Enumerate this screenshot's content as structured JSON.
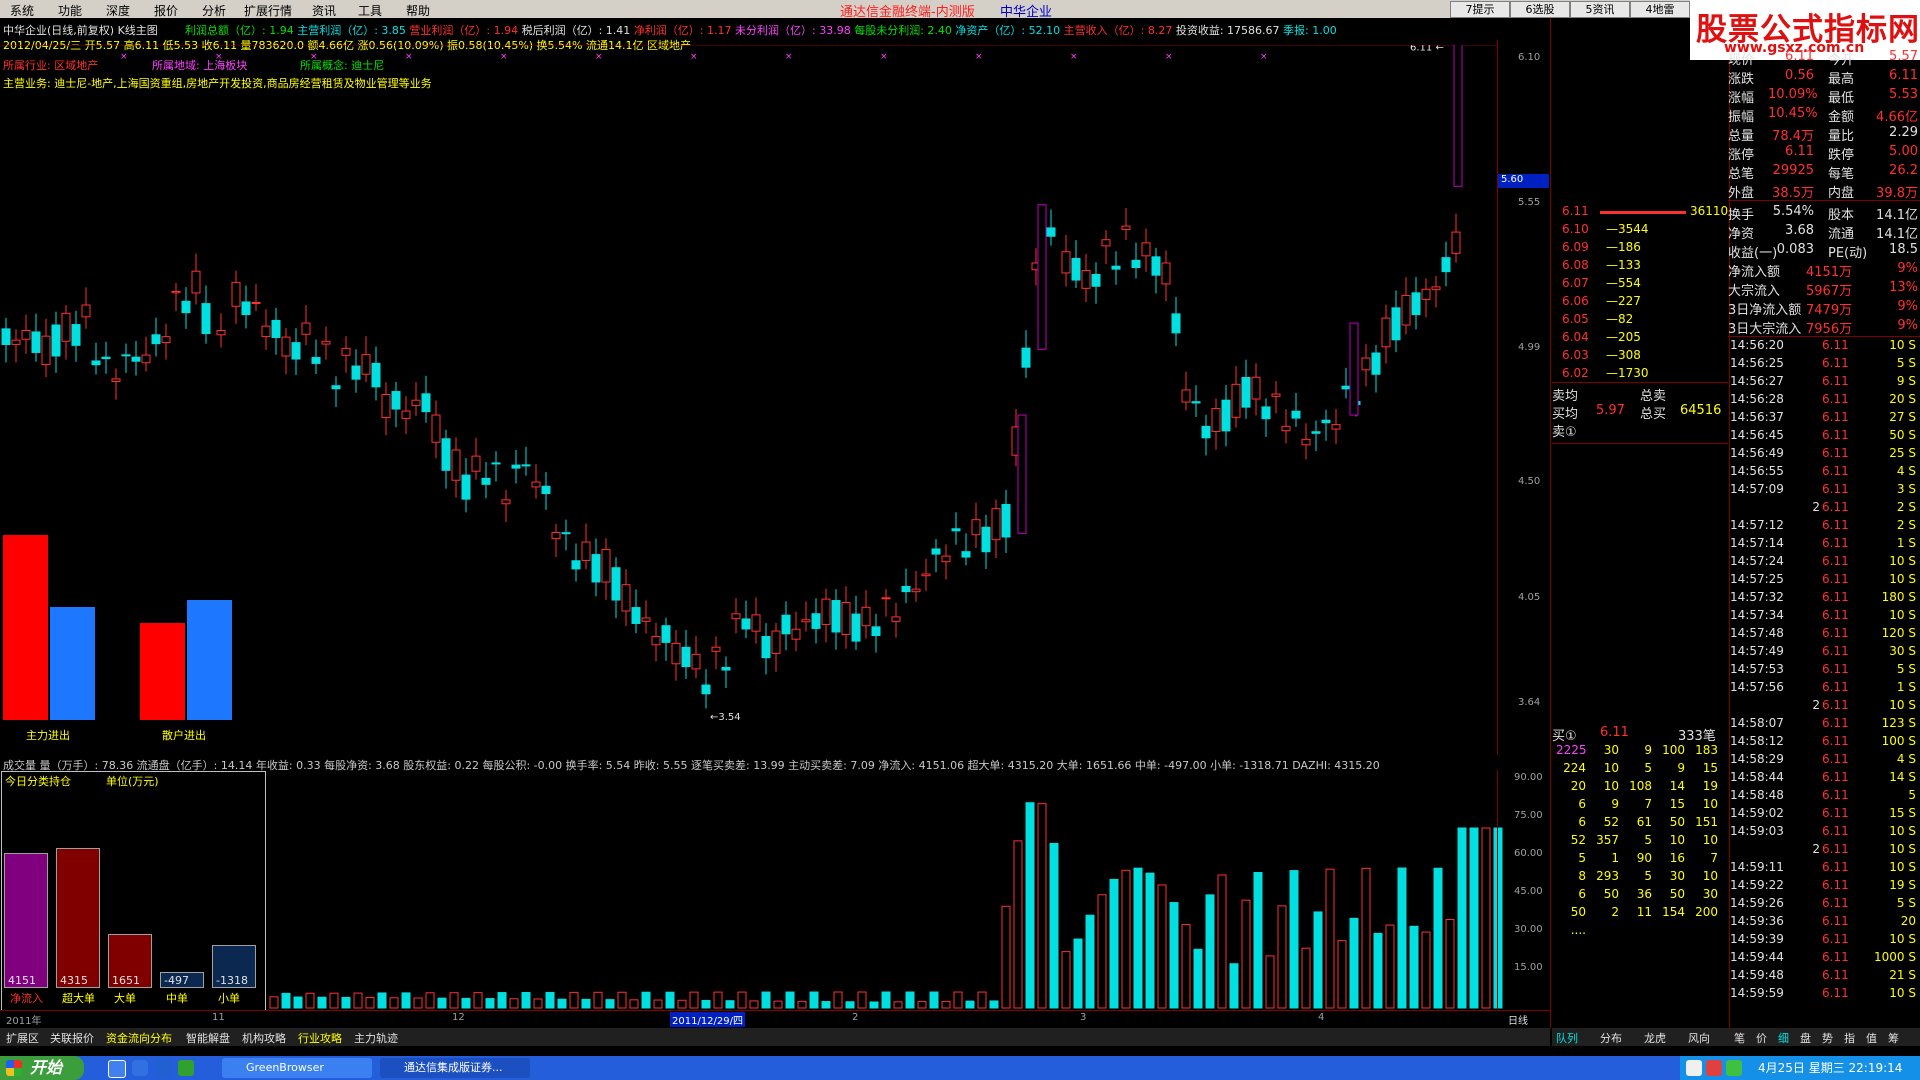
{
  "menu": [
    "系统",
    "功能",
    "深度",
    "报价",
    "分析",
    "扩展行情",
    "资讯",
    "工具",
    "帮助"
  ],
  "app_title": "通达信金融终端-内测版",
  "app_subtitle": "中华企业",
  "top_buttons": [
    "7提示",
    "6选股",
    "5资讯",
    "4地雷"
  ],
  "watermark": {
    "title": "股票公式指标网",
    "url": "www.gsxz.com.cn"
  },
  "header": {
    "stock": "中华企业(日线,前复权) K线主图",
    "fund1": [
      {
        "t": "利润总额（亿）: 1.94",
        "c": "g"
      },
      {
        "t": "主营利润（亿）: 3.85",
        "c": "c"
      },
      {
        "t": "营业利润（亿）: 1.94",
        "c": "r"
      },
      {
        "t": "税后利润（亿）: 1.41",
        "c": "w"
      },
      {
        "t": "净利润（亿）: 1.17",
        "c": "r"
      },
      {
        "t": "未分利润（亿）: 33.98",
        "c": "m"
      },
      {
        "t": "每股未分利润: 2.40",
        "c": "g"
      },
      {
        "t": "净资产（亿）: 52.10",
        "c": "c"
      },
      {
        "t": "主营收入（亿）: 8.27",
        "c": "r"
      },
      {
        "t": "投资收益: 17586.67",
        "c": "w"
      },
      {
        "t": "季报: 1.00",
        "c": "c"
      }
    ],
    "date_line": "2012/04/25/三 开5.57 高6.11 低5.53 收6.11 量783620.0 额4.66亿 涨0.56(10.09%) 振0.58(10.45%) 换5.54% 流通14.1亿 区域地产",
    "industry": "所属行业: 区域地产",
    "region": "所属地域: 上海板块",
    "concept": "所属概念: 迪士尼",
    "business": "主营业务: 迪士尼-地产,上海国资重组,房地产开发投资,商品房经营租赁及物业管理等业务"
  },
  "price_axis": [
    "6.10",
    "5.55",
    "4.99",
    "4.50",
    "4.05",
    "3.64"
  ],
  "price_marker": "5.60",
  "high_label": "6.11",
  "low_label": "3.54",
  "flow_boxes": {
    "main_label": "主力进出",
    "retail_label": "散户进出"
  },
  "indicator_line": "成交量 量（万手）: 78.36 流通盘（亿手）: 14.14 年收益: 0.33 每股净资: 3.68 股东权益: 0.22 每股公积: -0.00 换手率: 5.54 昨收: 5.55 逐笔买卖差: 13.99 主动买卖差: 7.09 净流入: 4151.06 超大单: 4315.20 大单: 1651.66 中单: -497.00 小单: -1318.71 DAZHI: 4315.20",
  "vol_axis": [
    "90.00",
    "75.00",
    "60.00",
    "45.00",
    "30.00",
    "15.00"
  ],
  "holding": {
    "title": "今日分类持仓",
    "unit": "单位(万元)",
    "bars": [
      {
        "label": "净流入",
        "value": "4151",
        "num": 4151,
        "color": "#800080"
      },
      {
        "label": "超大单",
        "value": "4315",
        "num": 4315,
        "color": "#800000"
      },
      {
        "label": "大单",
        "value": "1651",
        "num": 1651,
        "color": "#800000"
      },
      {
        "label": "中单",
        "value": "-497",
        "num": 497,
        "color": "#0a2850"
      },
      {
        "label": "小单",
        "value": "-1318",
        "num": 1318,
        "color": "#0a2850"
      }
    ]
  },
  "x_axis": [
    "2011年",
    "11",
    "12",
    "2011/12/29/四",
    "2",
    "3",
    "4"
  ],
  "period": "日线",
  "bottom_tabs": [
    "扩展区",
    "关联报价",
    "资金流向分布",
    "智能解盘",
    "机构攻略",
    "行业攻略",
    "主力轨迹"
  ],
  "right_tabs": [
    "队列",
    "分布",
    "龙虎",
    "风向"
  ],
  "right_tabs2": [
    "笔",
    "价",
    "细",
    "盘",
    "势",
    "指",
    "值",
    "筹"
  ],
  "quote": [
    {
      "l": "现价",
      "v": "6.11",
      "l2": "今开",
      "v2": "5.57"
    },
    {
      "l": "涨跌",
      "v": "0.56",
      "l2": "最高",
      "v2": "6.11"
    },
    {
      "l": "涨幅",
      "v": "10.09%",
      "l2": "最低",
      "v2": "5.53"
    },
    {
      "l": "振幅",
      "v": "10.45%",
      "l2": "金额",
      "v2": "4.66亿"
    },
    {
      "l": "总量",
      "v": "78.4万",
      "l2": "量比",
      "v2": "2.29"
    },
    {
      "l": "涨停",
      "v": "6.11",
      "l2": "跌停",
      "v2": "5.00"
    },
    {
      "l": "总笔",
      "v": "29925",
      "l2": "每笔",
      "v2": "26.2"
    },
    {
      "l": "外盘",
      "v": "38.5万",
      "l2": "内盘",
      "v2": "39.8万"
    },
    {
      "l": "换手",
      "v": "5.54%",
      "l2": "股本",
      "v2": "14.1亿"
    },
    {
      "l": "净资",
      "v": "3.68",
      "l2": "流通",
      "v2": "14.1亿"
    },
    {
      "l": "收益(一)",
      "v": "0.083",
      "l2": "PE(动)",
      "v2": "18.5"
    },
    {
      "l": "净流入额",
      "v": "4151万",
      "l2": "",
      "v2": "9%"
    },
    {
      "l": "大宗流入",
      "v": "5967万",
      "l2": "",
      "v2": "13%"
    },
    {
      "l": "3日净流入额",
      "v": "7479万",
      "l2": "",
      "v2": "9%"
    },
    {
      "l": "3日大宗流入",
      "v": "7956万",
      "l2": "",
      "v2": "9%"
    }
  ],
  "ticks": [
    [
      "14:56:20",
      "6.11",
      "10 S"
    ],
    [
      "14:56:25",
      "6.11",
      "5 S"
    ],
    [
      "14:56:27",
      "6.11",
      "9 S"
    ],
    [
      "14:56:28",
      "6.11",
      "20 S"
    ],
    [
      "14:56:37",
      "6.11",
      "27 S"
    ],
    [
      "14:56:45",
      "6.11",
      "50 S"
    ],
    [
      "14:56:49",
      "6.11",
      "25 S"
    ],
    [
      "14:56:55",
      "6.11",
      "4 S"
    ],
    [
      "14:57:09",
      "6.11",
      "3 S"
    ],
    [
      "2",
      "6.11",
      "2 S"
    ],
    [
      "14:57:12",
      "6.11",
      "2 S"
    ],
    [
      "14:57:14",
      "6.11",
      "1 S"
    ],
    [
      "14:57:24",
      "6.11",
      "10 S"
    ],
    [
      "14:57:25",
      "6.11",
      "10 S"
    ],
    [
      "14:57:32",
      "6.11",
      "180 S"
    ],
    [
      "14:57:34",
      "6.11",
      "10 S"
    ],
    [
      "14:57:48",
      "6.11",
      "120 S"
    ],
    [
      "14:57:49",
      "6.11",
      "30 S"
    ],
    [
      "14:57:53",
      "6.11",
      "5 S"
    ],
    [
      "14:57:56",
      "6.11",
      "1 S"
    ],
    [
      "2",
      "6.11",
      "10 S"
    ],
    [
      "14:58:07",
      "6.11",
      "123 S"
    ],
    [
      "14:58:12",
      "6.11",
      "100 S"
    ],
    [
      "14:58:29",
      "6.11",
      "4 S"
    ],
    [
      "14:58:44",
      "6.11",
      "14 S"
    ],
    [
      "14:58:48",
      "6.11",
      "5"
    ],
    [
      "14:59:02",
      "6.11",
      "15 S"
    ],
    [
      "14:59:03",
      "6.11",
      "10 S"
    ],
    [
      "2",
      "6.11",
      "10 S"
    ],
    [
      "14:59:11",
      "6.11",
      "10 S"
    ],
    [
      "14:59:22",
      "6.11",
      "19 S"
    ],
    [
      "14:59:26",
      "6.11",
      "5 S"
    ],
    [
      "14:59:36",
      "6.11",
      "20"
    ],
    [
      "14:59:39",
      "6.11",
      "10 S"
    ],
    [
      "14:59:44",
      "6.11",
      "1000 S"
    ],
    [
      "14:59:48",
      "6.11",
      "21 S"
    ],
    [
      "14:59:59",
      "6.11",
      "10 S"
    ]
  ],
  "order_book": [
    {
      "p": "6.11",
      "v": "36110"
    },
    {
      "p": "6.10",
      "v": "3544"
    },
    {
      "p": "6.09",
      "v": "186"
    },
    {
      "p": "6.08",
      "v": "133"
    },
    {
      "p": "6.07",
      "v": "554"
    },
    {
      "p": "6.06",
      "v": "227"
    },
    {
      "p": "6.05",
      "v": "82"
    },
    {
      "p": "6.04",
      "v": "205"
    },
    {
      "p": "6.03",
      "v": "308"
    },
    {
      "p": "6.02",
      "v": "1730"
    }
  ],
  "avg_block": {
    "sell_avg": "卖均",
    "buy_avg": "买均",
    "buy_avg_v": "5.97",
    "total_sell": "总卖",
    "total_buy": "总买",
    "total_buy_v": "64516",
    "sell1": "卖①"
  },
  "buy_queue": {
    "head": "买①",
    "price": "6.11",
    "count": "333笔",
    "rows": [
      [
        "2225",
        "30",
        "9",
        "100",
        "183"
      ],
      [
        "224",
        "10",
        "5",
        "9",
        "15"
      ],
      [
        "20",
        "10",
        "108",
        "14",
        "19"
      ],
      [
        "6",
        "9",
        "7",
        "15",
        "10"
      ],
      [
        "6",
        "52",
        "61",
        "50",
        "151"
      ],
      [
        "52",
        "357",
        "5",
        "10",
        "10"
      ],
      [
        "5",
        "1",
        "90",
        "16",
        "7"
      ],
      [
        "8",
        "293",
        "5",
        "30",
        "10"
      ],
      [
        "6",
        "50",
        "36",
        "50",
        "30"
      ],
      [
        "50",
        "2",
        "11",
        "154",
        "200"
      ],
      [
        "....",
        "",
        "",
        "",
        ""
      ]
    ]
  },
  "taskbar": {
    "start": "开始",
    "task1": "GreenBrowser",
    "task2": "通达信集成版证券...",
    "time": "4月25日 星期三 22:19:14"
  }
}
